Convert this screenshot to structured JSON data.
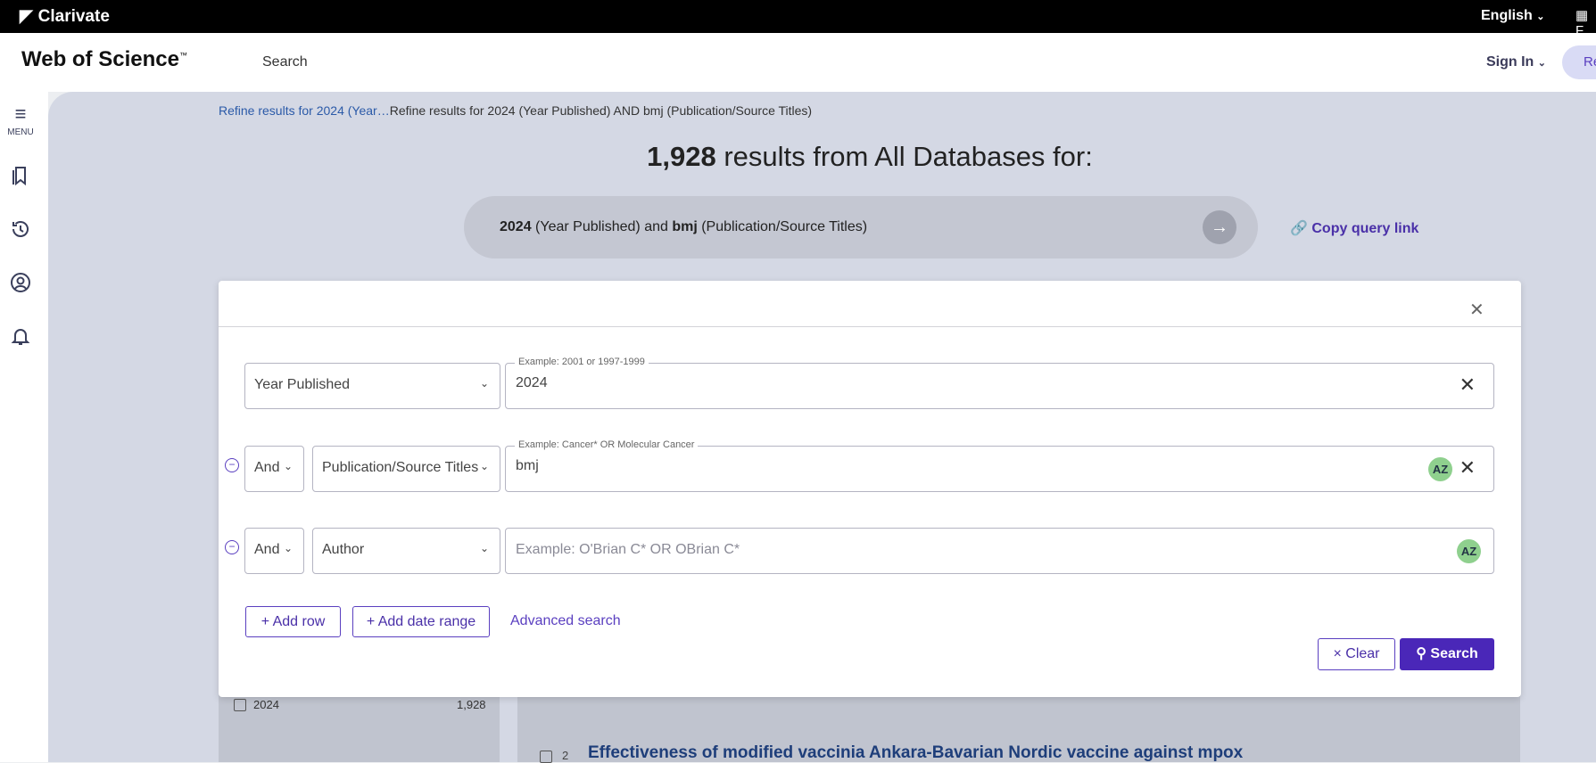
{
  "topbar": {
    "brand": "Clarivate",
    "language": "English",
    "apps_label": "▦ F"
  },
  "header": {
    "product": "Web of Science",
    "product_tm": "™",
    "nav_search": "Search",
    "sign_in": "Sign In",
    "register": "Re"
  },
  "rail": {
    "menu_label": "MENU"
  },
  "breadcrumb": {
    "link": "Refine results for 2024 (Year…",
    "current": "Refine results for 2024 (Year Published) AND bmj (Publication/Source Titles)"
  },
  "results": {
    "count": "1,928",
    "suffix": " results from All Databases for:"
  },
  "query": {
    "term1": "2024",
    "field1": " (Year Published) and ",
    "term2": "bmj",
    "field2": " (Publication/Source Titles)",
    "copy_link": "Copy query link"
  },
  "modal": {
    "rows": [
      {
        "field": "Year Published",
        "legend": "Example: 2001 or 1997-1999",
        "value": "2024"
      },
      {
        "bool": "And",
        "field": "Publication/Source Titles",
        "legend": "Example: Cancer* OR Molecular Cancer",
        "value": "bmj"
      },
      {
        "bool": "And",
        "field": "Author",
        "placeholder": "Example: O'Brian C* OR OBrian C*"
      }
    ],
    "add_row": "+ Add row",
    "add_date_range": "+ Add date range",
    "advanced_search": "Advanced search",
    "clear": "× Clear",
    "search": "Search"
  },
  "background": {
    "filter_year": "2024",
    "filter_count": "1,928",
    "article_num": "2",
    "article_title": "Effectiveness of modified vaccinia Ankara-Bavarian Nordic vaccine against mpox"
  },
  "colors": {
    "accent": "#4a27b8",
    "link": "#2b5aa8",
    "az_badge": "#8fd08e"
  }
}
